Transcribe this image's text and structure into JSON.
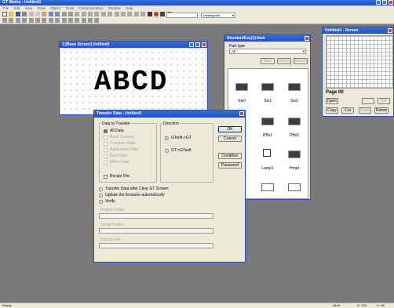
{
  "app": {
    "title": "GT Works - Untitled1"
  },
  "menu": [
    "File",
    "Edit",
    "View",
    "Draw",
    "Object",
    "Tools",
    "Communication",
    "Window",
    "Help"
  ],
  "toolbar": {
    "layer_dropdown": "Unassigned"
  },
  "screen_window": {
    "title": "1:[Base Screen] Untitled1",
    "text": "ABCD"
  },
  "parts_window": {
    "title": "StandardKey(1):Item",
    "field_label": "Part type",
    "field_value": "All",
    "btn_new": "New",
    "btn_delete": "Delete",
    "btn_rename": "Rename",
    "parts": [
      {
        "label": "Sw0"
      },
      {
        "label": "Sw1"
      },
      {
        "label": "Sw2"
      },
      {
        "label": "PBs1"
      },
      {
        "label": "PBs2"
      },
      {
        "label": "Lamp1"
      },
      {
        "label": "Hmpt"
      }
    ]
  },
  "page_window": {
    "title": "Untitled1 - Screen",
    "page_label": "Page 00",
    "btn_open": "Open",
    "btn_new": "",
    "btn_init": "Init",
    "btn_copy": "Copy",
    "btn_cut": "Cut",
    "btn_paste": "Paste",
    "btn_delete": "Delete"
  },
  "dialog": {
    "title": "Transfer Data - Untitled1",
    "group_data": "Data to Transfer",
    "items": [
      {
        "label": "All Data",
        "checked": true,
        "enabled": true
      },
      {
        "label": "Base Screens",
        "checked": false,
        "enabled": false
      },
      {
        "label": "Common Data",
        "checked": false,
        "enabled": false
      },
      {
        "label": "Application Data",
        "checked": false,
        "enabled": false
      },
      {
        "label": "Font Data",
        "checked": false,
        "enabled": false
      },
      {
        "label": "Other Data",
        "checked": false,
        "enabled": false
      }
    ],
    "recipe": "Recipe File",
    "group_direction": "Direction",
    "dir1": "GTsoft->GT",
    "dir2": "GT->GTsoft",
    "btn_ok": "OK",
    "btn_cancel": "Cancel",
    "btn_condition": "Condition",
    "btn_password": "Password",
    "opt1": "Transfer Data after Clear GT Screen",
    "opt2": "Update the firmware automatically",
    "opt3": "Verify",
    "field1_label": "Project Folder",
    "field2_label": "Target Folder",
    "field3_label": "Backup File"
  },
  "status": {
    "ready": "Ready",
    "f1": "NUM",
    "f2": "0 / 100",
    "f3": "0 / 80"
  }
}
